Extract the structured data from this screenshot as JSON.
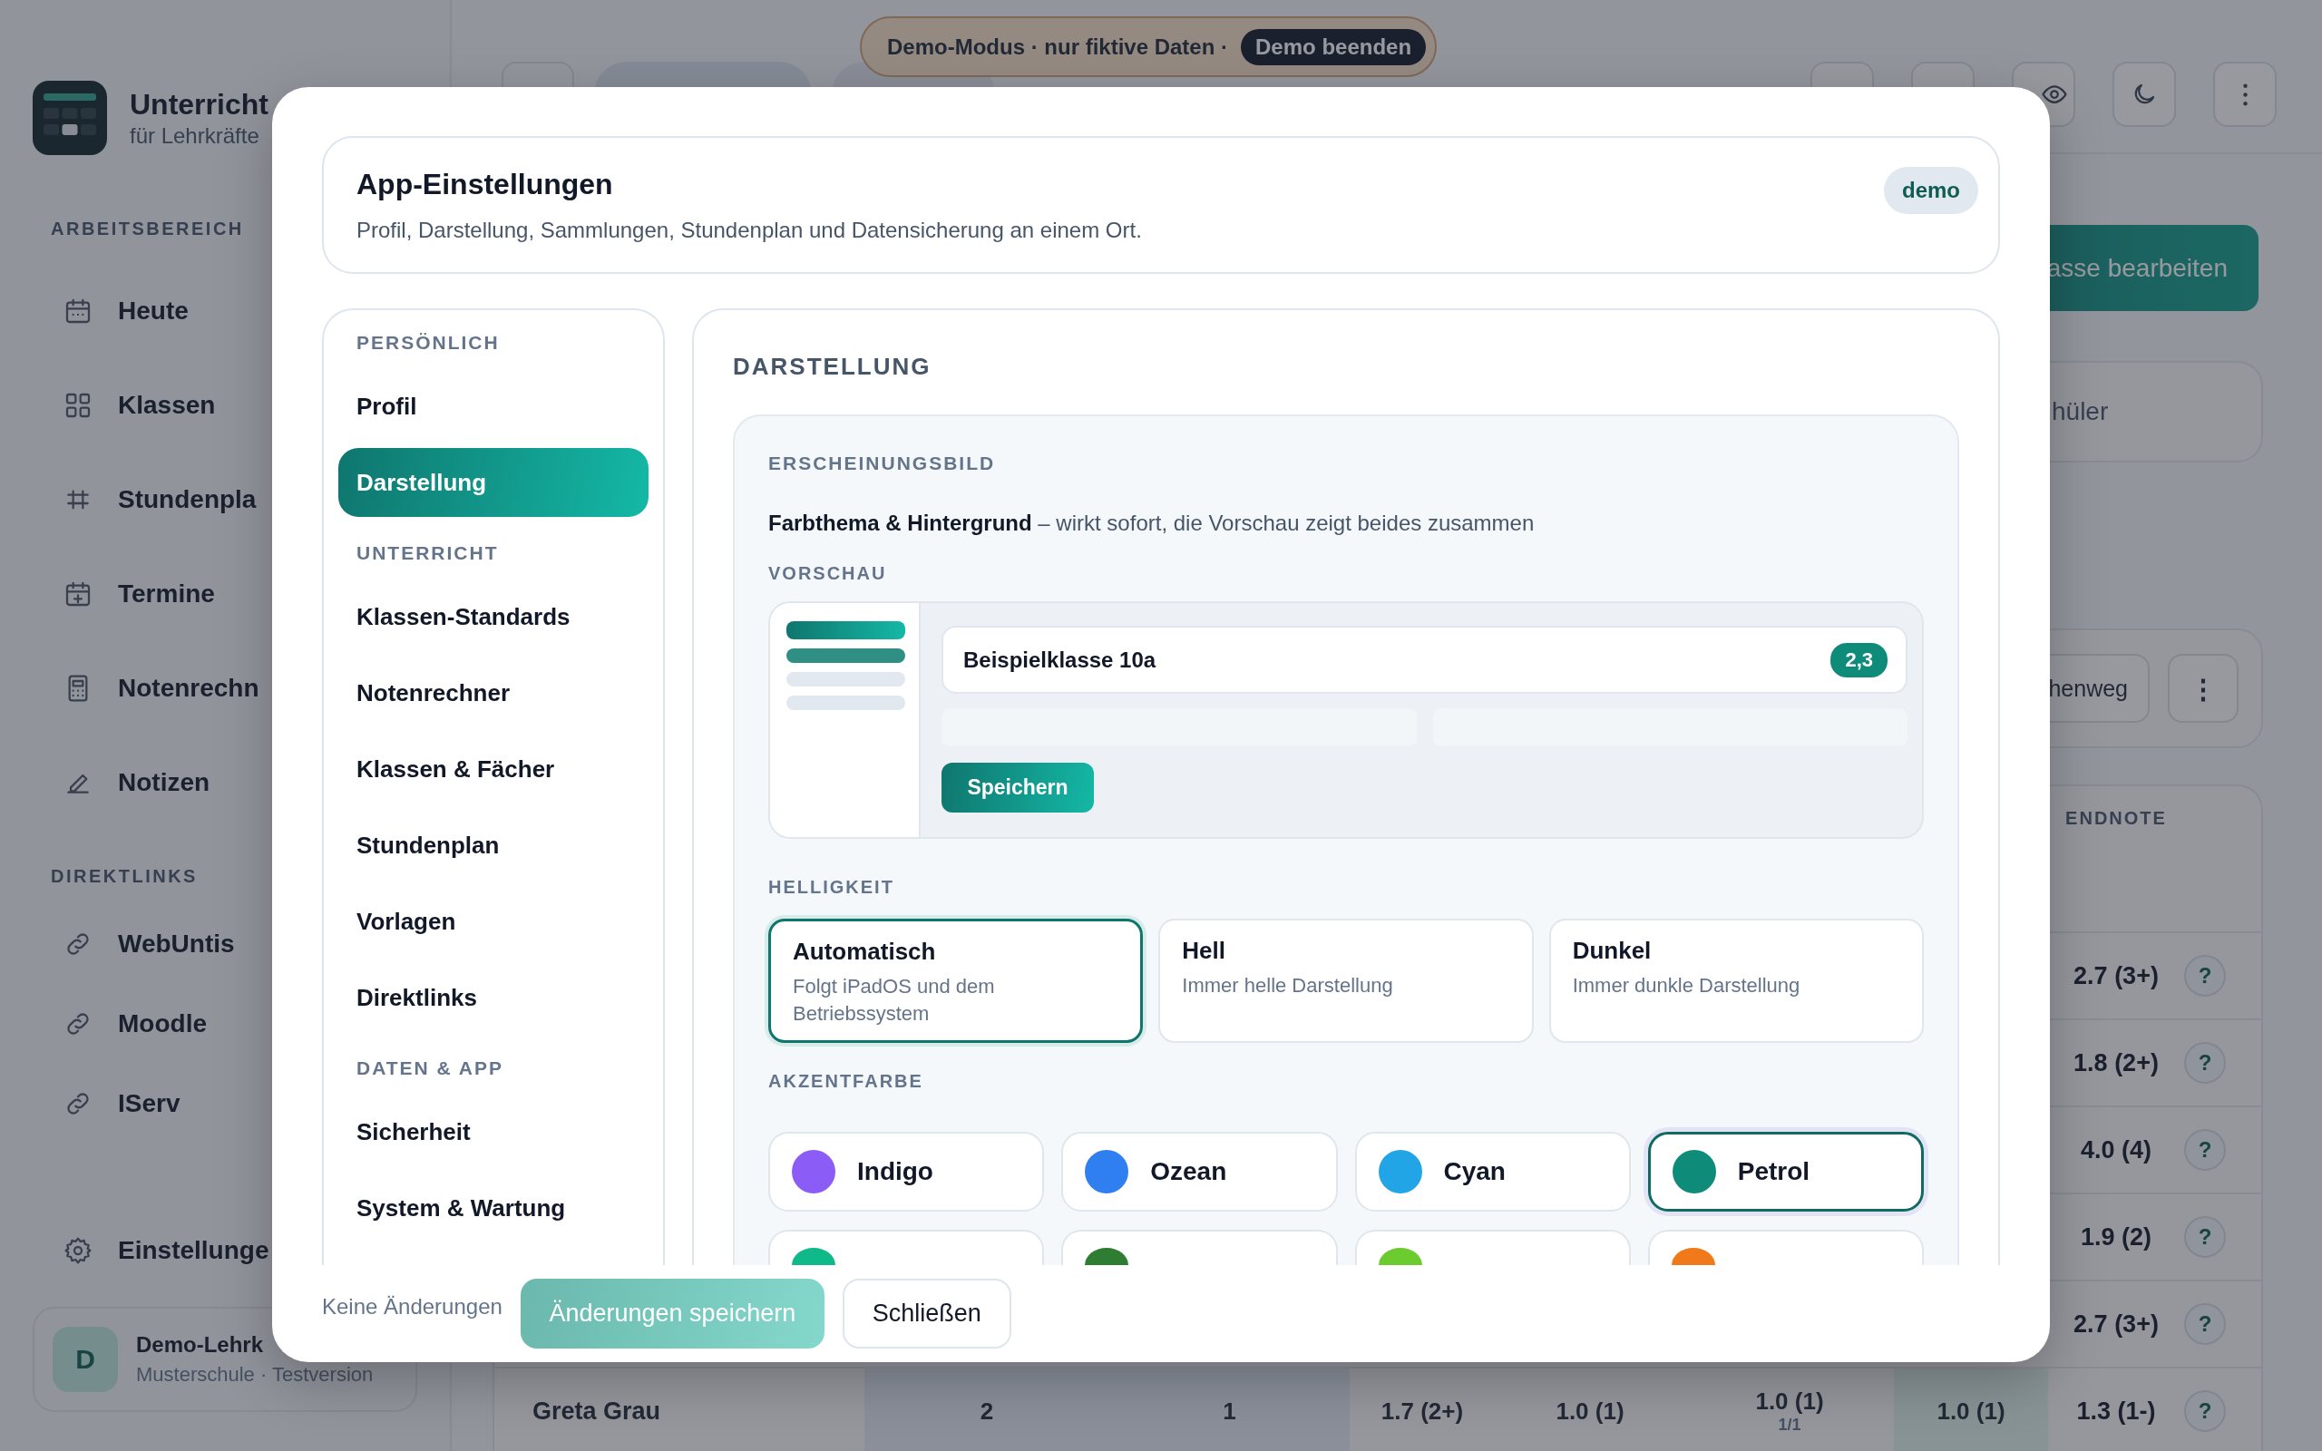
{
  "demo_banner": {
    "text": "Demo-Modus · nur fiktive Daten ·",
    "button": "Demo beenden"
  },
  "app": {
    "title": "Unterricht",
    "subtitle": "für Lehrkräfte"
  },
  "sidebar": {
    "sections": [
      {
        "label": "ARBEITSBEREICH",
        "items": [
          {
            "label": "Heute"
          },
          {
            "label": "Klassen"
          },
          {
            "label": "Stundenpla"
          },
          {
            "label": "Termine"
          },
          {
            "label": "Notenrechn"
          },
          {
            "label": "Notizen"
          }
        ]
      },
      {
        "label": "DIREKTLINKS",
        "items": [
          {
            "label": "WebUntis"
          },
          {
            "label": "Moodle"
          },
          {
            "label": "IServ"
          }
        ]
      }
    ],
    "settings": {
      "label": "Einstellunge"
    },
    "user": {
      "avatar": "D",
      "name": "Demo-Lehrk",
      "school": "Musterschule · Testversion"
    }
  },
  "main": {
    "edit_button": "asse bearbeiten",
    "search_text": "hüler",
    "filter_button": "henweg",
    "more_button": "⋮",
    "table": {
      "endnote_header": "ENDNOTE",
      "rows": [
        {
          "endnote": "2.7 (3+)",
          "help": "?"
        },
        {
          "endnote": "1.8 (2+)",
          "help": "?"
        },
        {
          "endnote": "4.0 (4)",
          "help": "?"
        },
        {
          "endnote": "1.9 (2)",
          "help": "?"
        },
        {
          "endnote": "2.7 (3+)",
          "help": "?"
        },
        {
          "name": "Greta Grau",
          "cells": [
            {
              "text": "2"
            },
            {
              "text": "1"
            },
            {
              "text": "1.7 (2+)"
            },
            {
              "text": "1.0 (1)"
            },
            {
              "text": "1.0 (1)",
              "sub": "1/1"
            },
            {
              "text": "1.0 (1)"
            }
          ],
          "endnote": "1.3 (1-)",
          "help": "?"
        }
      ]
    }
  },
  "settings_dialog": {
    "title": "App-Einstellungen",
    "subtitle": "Profil, Darstellung, Sammlungen, Stundenplan und Datensicherung an einem Ort.",
    "badge": "demo",
    "nav": [
      {
        "section": "PERSÖNLICH",
        "items": [
          {
            "label": "Profil",
            "selected": false
          },
          {
            "label": "Darstellung",
            "selected": true
          }
        ]
      },
      {
        "section": "UNTERRICHT",
        "items": [
          {
            "label": "Klassen-Standards",
            "selected": false
          },
          {
            "label": "Notenrechner",
            "selected": false
          },
          {
            "label": "Klassen & Fächer",
            "selected": false
          },
          {
            "label": "Stundenplan",
            "selected": false
          },
          {
            "label": "Vorlagen",
            "selected": false
          },
          {
            "label": "Direktlinks",
            "selected": false
          }
        ]
      },
      {
        "section": "DATEN & APP",
        "items": [
          {
            "label": "Sicherheit",
            "selected": false
          },
          {
            "label": "System & Wartung",
            "selected": false
          }
        ]
      }
    ],
    "section_title": "DARSTELLUNG",
    "appearance": {
      "heading": "ERSCHEINUNGSBILD",
      "description": "**Farbthema & Hintergrund** – wirkt sofort, die Vorschau zeigt beides zusammen",
      "preview_label": "VORSCHAU",
      "preview": {
        "class_name": "Beispielklasse 10a",
        "grade": "2,3",
        "button": "Speichern"
      },
      "brightness_label": "HELLIGKEIT",
      "brightness_options": [
        {
          "title": "Automatisch",
          "description": "Folgt iPadOS und dem Betriebssystem",
          "selected": true
        },
        {
          "title": "Hell",
          "description": "Immer helle Darstellung",
          "selected": false
        },
        {
          "title": "Dunkel",
          "description": "Immer dunkle Darstellung",
          "selected": false
        }
      ],
      "accent_label": "AKZENTFARBE",
      "accent_colors": [
        {
          "name": "Indigo",
          "color": "#8b5cf6",
          "selected": false
        },
        {
          "name": "Ozean",
          "color": "#2f7ff0",
          "selected": false
        },
        {
          "name": "Cyan",
          "color": "#22a5e6",
          "selected": false
        },
        {
          "name": "Petrol",
          "color": "#0f8b7a",
          "selected": true
        },
        {
          "color": "#10b98a",
          "selected": false
        },
        {
          "color": "#2e7d32",
          "selected": false
        },
        {
          "color": "#6ccb2e",
          "selected": false
        },
        {
          "color": "#f07a1a",
          "selected": false
        }
      ]
    },
    "footer": {
      "status": "Keine Änderungen",
      "save_button": {
        "label": "Änderungen speichern",
        "disabled": true
      },
      "close_button": "Schließen"
    }
  }
}
